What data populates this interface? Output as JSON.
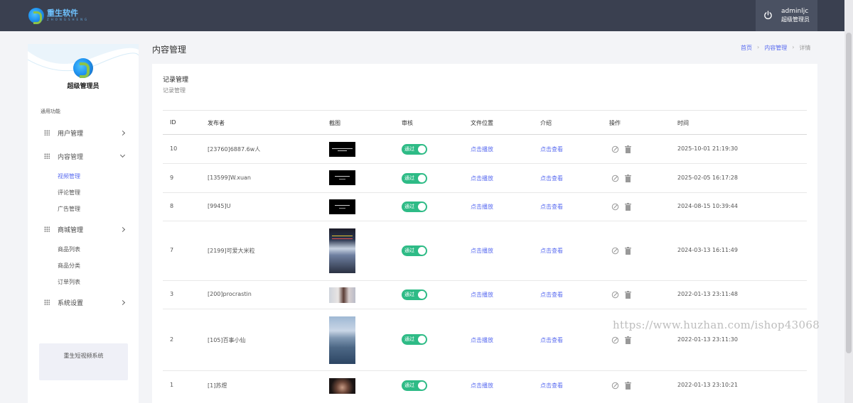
{
  "topbar": {
    "logo_name": "重生软件",
    "logo_sub": "ZHONGSHENG",
    "user_name": "adminljc",
    "user_role": "超级管理员"
  },
  "sidebar": {
    "avatar_label": "超级管理员",
    "section_label": "通用功能",
    "menu": {
      "users": "用户管理",
      "content": "内容管理",
      "shop": "商城管理",
      "settings": "系统设置"
    },
    "content_sub": [
      "视频管理",
      "评论管理",
      "广告管理"
    ],
    "shop_sub": [
      "商品列表",
      "商品分类",
      "订单列表"
    ],
    "system_name": "重生短视频系统"
  },
  "header": {
    "page_title": "内容管理",
    "breadcrumb": [
      "首页",
      "内容管理",
      "详情"
    ]
  },
  "panel": {
    "title": "记录管理",
    "subtitle": "记录管理",
    "columns": [
      "ID",
      "发布者",
      "截图",
      "审核",
      "文件位置",
      "介绍",
      "操作",
      "时间"
    ],
    "rows": [
      {
        "id": "10",
        "publisher": "[23760]6887.6w人",
        "status": "通过",
        "file": "点击播放",
        "intro": "点击查看",
        "time": "2025-10-01 21:19:30"
      },
      {
        "id": "9",
        "publisher": "[13599]W.xuan",
        "status": "通过",
        "file": "点击播放",
        "intro": "点击查看",
        "time": "2025-02-05 16:17:28"
      },
      {
        "id": "8",
        "publisher": "[9945]U",
        "status": "通过",
        "file": "点击播放",
        "intro": "点击查看",
        "time": "2024-08-15 10:39:44"
      },
      {
        "id": "7",
        "publisher": "[2199]可爱大米粒",
        "status": "通过",
        "file": "点击播放",
        "intro": "点击查看",
        "time": "2024-03-13 16:11:49"
      },
      {
        "id": "3",
        "publisher": "[200]procrastin",
        "status": "通过",
        "file": "点击播放",
        "intro": "点击查看",
        "time": "2022-01-13 23:11:48"
      },
      {
        "id": "2",
        "publisher": "[105]百事小仙",
        "status": "通过",
        "file": "点击播放",
        "intro": "点击查看",
        "time": "2022-01-13 23:11:30"
      },
      {
        "id": "1",
        "publisher": "[1]苏煜",
        "status": "通过",
        "file": "点击播放",
        "intro": "点击查看",
        "time": "2022-01-13 23:10:21"
      }
    ]
  },
  "watermark": "https://www.huzhan.com/ishop43068",
  "colors": {
    "topbar": "#3a4050",
    "accent": "#5a6cf0",
    "toggle_on": "#2ebb86",
    "background": "#f3f4f7"
  },
  "icons": [
    "power-icon",
    "grid-icon",
    "chevron-right-icon",
    "chevron-down-icon",
    "edit-icon",
    "trash-icon"
  ]
}
